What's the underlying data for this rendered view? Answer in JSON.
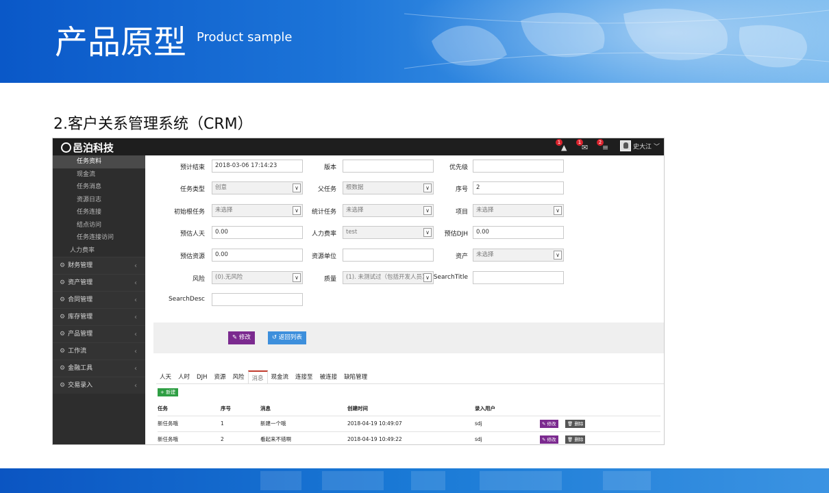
{
  "slide": {
    "title": "产品原型",
    "subtitle": "Product sample",
    "section": "2.客户关系管理系统（CRM）"
  },
  "app": {
    "logo": "邑泊科技",
    "notifications": [
      {
        "icon": "alert-icon",
        "count": "1",
        "glyph": "▲"
      },
      {
        "icon": "mail-icon",
        "count": "1",
        "glyph": "✉"
      },
      {
        "icon": "tasks-icon",
        "count": "2",
        "glyph": "≡"
      }
    ],
    "user": {
      "name": "史大江",
      "caret": "﹀"
    }
  },
  "sidebar": {
    "subitems": [
      {
        "label": "任务资料",
        "active": true
      },
      {
        "label": "现金流"
      },
      {
        "label": "任务消息"
      },
      {
        "label": "资源日志"
      },
      {
        "label": "任务连接"
      },
      {
        "label": "结点访问"
      },
      {
        "label": "任务连接访问"
      },
      {
        "label": "人力费率",
        "level1": true
      }
    ],
    "menus": [
      {
        "label": "财务管理"
      },
      {
        "label": "资产管理"
      },
      {
        "label": "合同管理"
      },
      {
        "label": "库存管理"
      },
      {
        "label": "产品管理"
      },
      {
        "label": "工作流"
      },
      {
        "label": "金融工具"
      },
      {
        "label": "交易录入"
      }
    ]
  },
  "form": {
    "fields": [
      {
        "label": "预计结束",
        "value": "2018-03-06 17:14:23",
        "type": "text"
      },
      {
        "label": "版本",
        "value": "",
        "type": "text"
      },
      {
        "label": "优先级",
        "value": "",
        "type": "text"
      },
      {
        "label": "任务类型",
        "value": "创意",
        "type": "select"
      },
      {
        "label": "父任务",
        "value": "根数据",
        "type": "select"
      },
      {
        "label": "序号",
        "value": "2",
        "type": "text"
      },
      {
        "label": "初始根任务",
        "value": "未选择",
        "type": "select"
      },
      {
        "label": "统计任务",
        "value": "未选择",
        "type": "select"
      },
      {
        "label": "项目",
        "value": "未选择",
        "type": "select"
      },
      {
        "label": "预估人天",
        "value": "0.00",
        "type": "text"
      },
      {
        "label": "人力费率",
        "value": "test",
        "type": "select"
      },
      {
        "label": "预估DJH",
        "value": "0.00",
        "type": "text"
      },
      {
        "label": "预估资源",
        "value": "0.00",
        "type": "text"
      },
      {
        "label": "资源单位",
        "value": "",
        "type": "text"
      },
      {
        "label": "资产",
        "value": "未选择",
        "type": "select"
      },
      {
        "label": "风险",
        "value": "(0).无风险",
        "type": "select"
      },
      {
        "label": "质量",
        "value": "(1). 未测试过（包括开发人员）",
        "type": "select"
      },
      {
        "label": "SearchTitle",
        "value": "",
        "type": "text"
      },
      {
        "label": "SearchDesc",
        "value": "",
        "type": "text"
      }
    ],
    "edit_label": "✎ 修改",
    "back_label": "↺ 返回列表"
  },
  "tabs": {
    "items": [
      "人天",
      "人时",
      "DJH",
      "资源",
      "风险",
      "消息",
      "现金流",
      "连接至",
      "被连接",
      "缺陷管理"
    ],
    "active": "消息",
    "new_label": "+ 新建"
  },
  "table": {
    "headers": [
      "任务",
      "序号",
      "消息",
      "创建时间",
      "录入用户"
    ],
    "rows": [
      {
        "task": "新任务哦",
        "seq": "1",
        "msg": "新建一个哦",
        "time": "2018-04-19 10:49:07",
        "user": "sdj"
      },
      {
        "task": "新任务哦",
        "seq": "2",
        "msg": "看起来不错啊",
        "time": "2018-04-19 10:49:22",
        "user": "sdj"
      }
    ],
    "row_edit": "✎ 修改",
    "row_delete": "🗑 删除"
  }
}
